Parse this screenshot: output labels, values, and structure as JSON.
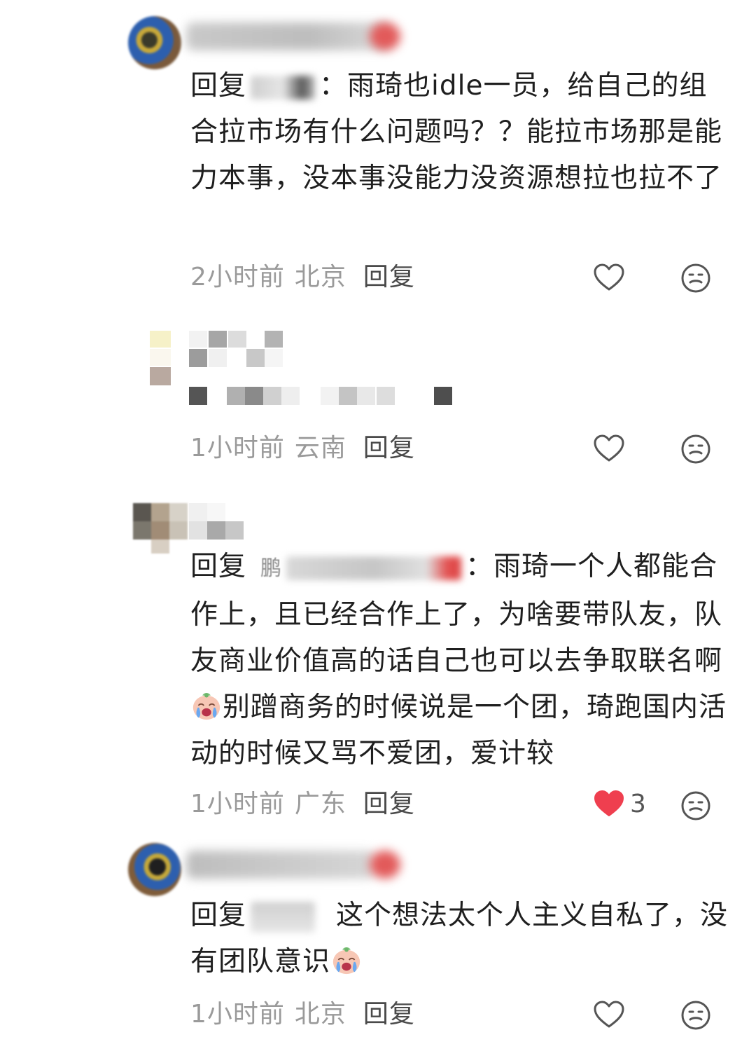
{
  "comments": [
    {
      "reply_prefix": "回复",
      "mention_end": "：",
      "text": "雨琦也idle一员，给自己的组合拉市场有什么问题吗？？能拉市场那是能力本事，没本事没能力没资源想拉也拉不了",
      "time": "2小时前",
      "location": "北京",
      "reply_label": "回复",
      "liked": false
    },
    {
      "time": "1小时前",
      "location": "云南",
      "reply_label": "回复",
      "liked": false
    },
    {
      "reply_prefix": "回复",
      "mention_visible": "鹏",
      "mention_end": "：",
      "text": "雨琦一个人都能合作上，且已经合作上了，为啥要带队友，队友商业价值高的话自己也可以去争取联名啊",
      "text_after_emoji": "别蹭商务的时候说是一个团，琦跑国内活动的时候又骂不爱团，爱计较",
      "emoji": "crying-emoji",
      "time": "1小时前",
      "location": "广东",
      "reply_label": "回复",
      "liked": true,
      "like_count": "3"
    },
    {
      "reply_prefix": "回复",
      "text": "这个想法太个人主义自私了，没有团队意识",
      "emoji": "crying-emoji",
      "time": "1小时前",
      "location": "北京",
      "reply_label": "回复",
      "liked": false
    }
  ],
  "colors": {
    "like_active": "#ef3f4f",
    "meta_gray": "#9a9a9a",
    "icon_gray": "#666666"
  }
}
